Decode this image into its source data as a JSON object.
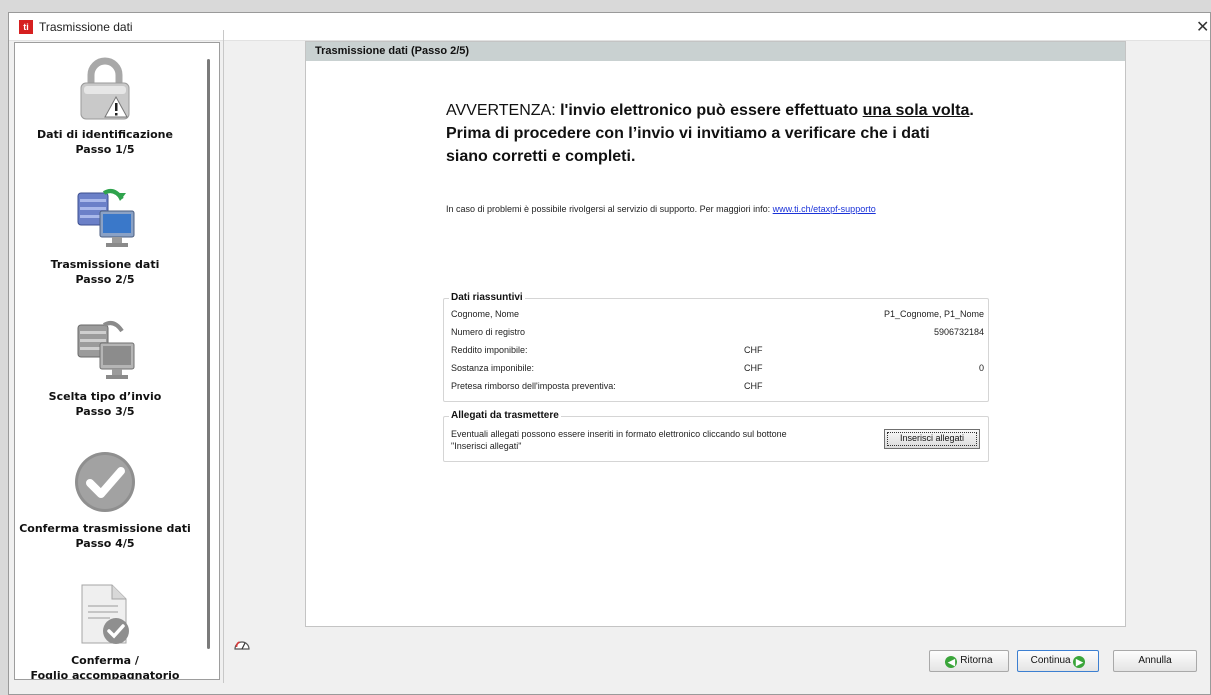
{
  "window": {
    "title": "Trasmissione dati",
    "app_icon": "ti"
  },
  "sidebar": {
    "steps": [
      {
        "label1": "Dati di identificazione",
        "label2": "Passo 1/5",
        "icon": "lock-warning-icon"
      },
      {
        "label1": "Trasmissione dati",
        "label2": "Passo 2/5",
        "icon": "database-transfer-icon"
      },
      {
        "label1": "Scelta tipo d’invio",
        "label2": "Passo 3/5",
        "icon": "database-transfer-grey-icon"
      },
      {
        "label1": "Conferma trasmissione dati",
        "label2": "Passo 4/5",
        "icon": "checkmark-circle-icon"
      },
      {
        "label1": "Conferma /",
        "label2": "Foglio accompagnatorio",
        "icon": "document-check-icon"
      }
    ]
  },
  "panel": {
    "header": "Trasmissione dati (Passo 2/5)",
    "warning": {
      "prefix": "AVVERTENZA: ",
      "bold1": "l'invio elettronico può essere effettuato ",
      "underlined": "una sola volta",
      "after": ".",
      "line2": "Prima di procedere con l’invio vi invitiamo a verificare che i dati",
      "line3": "siano corretti e completi."
    },
    "support_text": "In caso di problemi è possibile rivolgersi al servizio di supporto. Per maggiori info: ",
    "support_link": "www.ti.ch/etaxpf-supporto",
    "summary": {
      "title": "Dati riassuntivi",
      "rows": [
        {
          "key": "Cognome, Nome",
          "currency": "",
          "value": "P1_Cognome, P1_Nome"
        },
        {
          "key": "Numero di registro",
          "currency": "",
          "value": "5906732184"
        },
        {
          "key": "Reddito imponibile:",
          "currency": "CHF",
          "value": ""
        },
        {
          "key": "Sostanza imponibile:",
          "currency": "CHF",
          "value": "0"
        },
        {
          "key": "Pretesa rimborso dell'imposta preventiva:",
          "currency": "CHF",
          "value": ""
        }
      ]
    },
    "attachments": {
      "title": "Allegati da trasmettere",
      "text": "Eventuali allegati possono essere inseriti in formato elettronico cliccando sul bottone \"Inserisci allegati\"",
      "button": "Inserisci allegati"
    }
  },
  "footer": {
    "back": "Ritorna",
    "next": "Continua",
    "cancel": "Annulla"
  }
}
